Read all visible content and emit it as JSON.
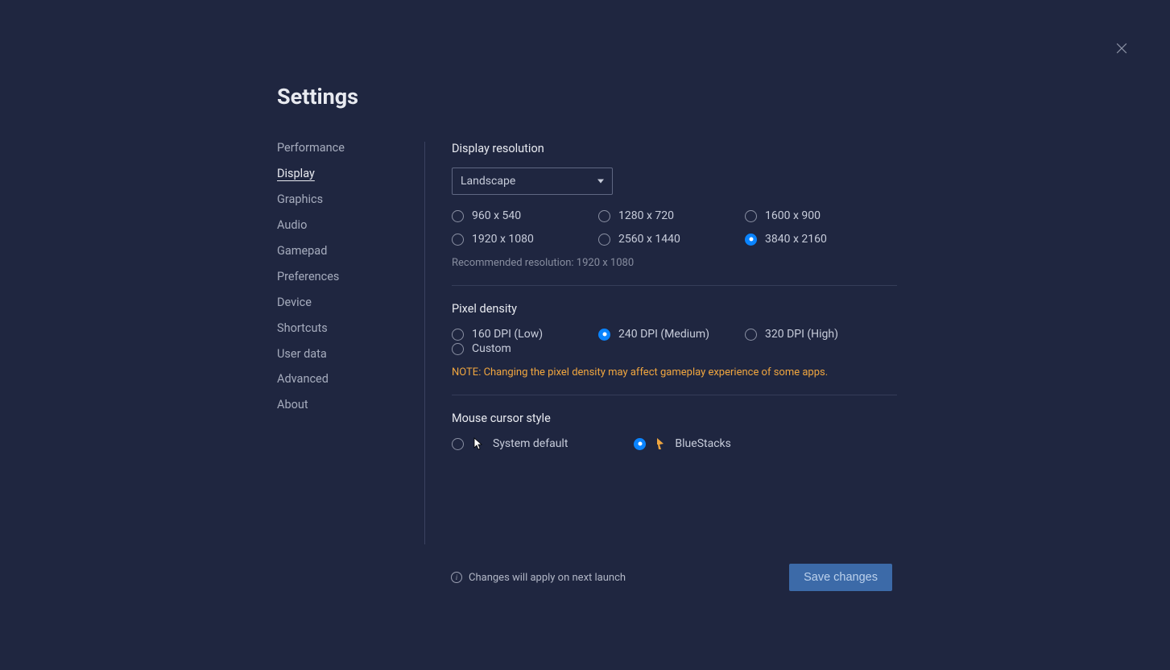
{
  "title": "Settings",
  "sidebar": {
    "items": [
      {
        "label": "Performance"
      },
      {
        "label": "Display"
      },
      {
        "label": "Graphics"
      },
      {
        "label": "Audio"
      },
      {
        "label": "Gamepad"
      },
      {
        "label": "Preferences"
      },
      {
        "label": "Device"
      },
      {
        "label": "Shortcuts"
      },
      {
        "label": "User data"
      },
      {
        "label": "Advanced"
      },
      {
        "label": "About"
      }
    ],
    "active_index": 1
  },
  "display_resolution": {
    "title": "Display resolution",
    "orientation_selected": "Landscape",
    "options": [
      "960 x 540",
      "1280 x 720",
      "1600 x 900",
      "1920 x 1080",
      "2560 x 1440",
      "3840 x 2160"
    ],
    "selected_index": 5,
    "recommended_text": "Recommended resolution: 1920 x 1080"
  },
  "pixel_density": {
    "title": "Pixel density",
    "options": [
      "160 DPI (Low)",
      "240 DPI (Medium)",
      "320 DPI (High)",
      "Custom"
    ],
    "selected_index": 1,
    "note": "NOTE: Changing the pixel density may affect gameplay experience of some apps."
  },
  "mouse_cursor": {
    "title": "Mouse cursor style",
    "options": [
      "System default",
      "BlueStacks"
    ],
    "selected_index": 1
  },
  "footer": {
    "notice": "Changes will apply on next launch",
    "save_label": "Save changes"
  }
}
